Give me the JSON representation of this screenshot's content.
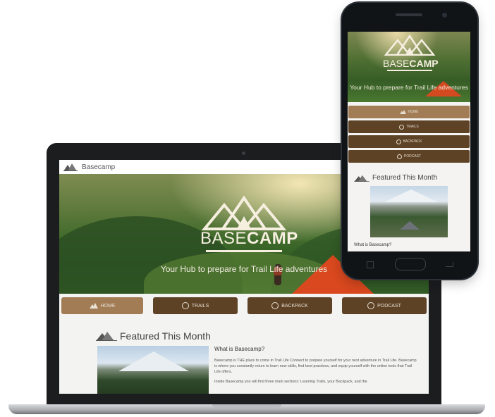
{
  "app": {
    "brand": "Basecamp",
    "logo_word_light": "BASE",
    "logo_word_bold": "CAMP",
    "tagline": "Your Hub to prepare for Trail Life adventures"
  },
  "menu": [
    {
      "label": "HOME",
      "icon": "mountain-icon",
      "active": true
    },
    {
      "label": "TRAILS",
      "icon": "trail-icon",
      "active": false
    },
    {
      "label": "BACKPACK",
      "icon": "backpack-icon",
      "active": false
    },
    {
      "label": "PODCAST",
      "icon": "podcast-icon",
      "active": false
    }
  ],
  "featured": {
    "title": "Featured This Month",
    "article_heading": "What is Basecamp?",
    "paragraphs": [
      "Basecamp is THE place to come in Trail Life Connect to prepare yourself for your next adventure in Trail Life. Basecamp is where you constantly return to learn new skills, find best practices, and equip yourself with the online tools that Trail Life offers.",
      "Inside Basecamp you will find three main sections: Learning Trails, your Backpack, and the"
    ]
  },
  "colors": {
    "accent_light": "#a27c55",
    "accent_dark": "#5d4226",
    "tent": "#d9481e"
  }
}
